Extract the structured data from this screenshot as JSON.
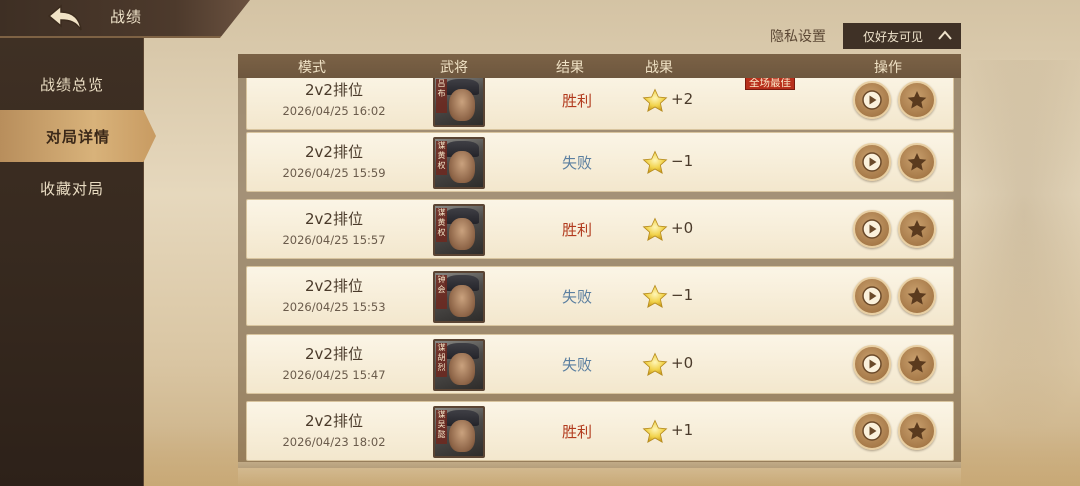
{
  "header": {
    "title": "战绩",
    "back_icon": "back-arrow-icon"
  },
  "sidebar": {
    "items": [
      {
        "label": "战绩总览"
      },
      {
        "label": "对局详情",
        "active": true
      },
      {
        "label": "收藏对局"
      }
    ]
  },
  "privacy": {
    "label": "隐私设置",
    "value": "仅好友可见",
    "icon": "chevron-up-icon"
  },
  "table": {
    "headers": {
      "mode": "模式",
      "general": "武将",
      "result": "结果",
      "score": "战果",
      "actions": "操作"
    },
    "rows": [
      {
        "mode": "2v2排位",
        "time": "2026/04/25 16:02",
        "general_tag": "吕布",
        "result": "胜利",
        "result_type": "win",
        "score": "+2",
        "badge": "全场最佳"
      },
      {
        "mode": "2v2排位",
        "time": "2026/04/25 15:59",
        "general_tag": "谋黄权",
        "result": "失败",
        "result_type": "lose",
        "score": "−1",
        "badge": ""
      },
      {
        "mode": "2v2排位",
        "time": "2026/04/25 15:57",
        "general_tag": "谋黄权",
        "result": "胜利",
        "result_type": "win",
        "score": "+0",
        "badge": ""
      },
      {
        "mode": "2v2排位",
        "time": "2026/04/25 15:53",
        "general_tag": "钟会",
        "result": "失败",
        "result_type": "lose",
        "score": "−1",
        "badge": ""
      },
      {
        "mode": "2v2排位",
        "time": "2026/04/25 15:47",
        "general_tag": "谋胡烈",
        "result": "失败",
        "result_type": "lose",
        "score": "+0",
        "badge": ""
      },
      {
        "mode": "2v2排位",
        "time": "2026/04/23 18:02",
        "general_tag": "谋吴懿",
        "result": "胜利",
        "result_type": "win",
        "score": "+1",
        "badge": ""
      }
    ]
  },
  "colors": {
    "win": "#b23b1e",
    "lose": "#5b7fa0",
    "badge": "#b8301c"
  }
}
